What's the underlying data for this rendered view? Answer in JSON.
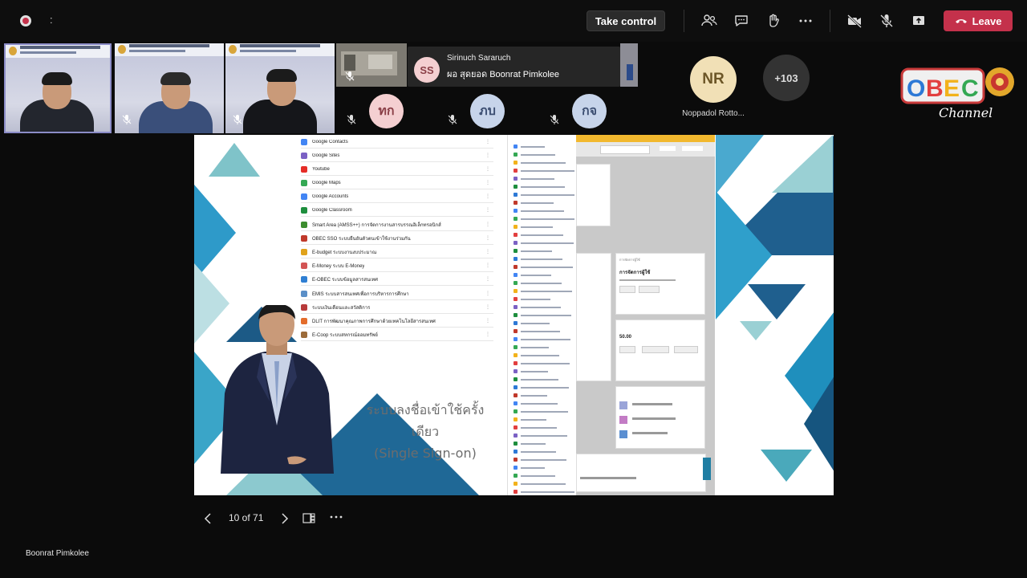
{
  "top_bar": {
    "recording_indicator": "record-icon",
    "timer_text": ":",
    "take_control_label": "Take control",
    "icons": [
      "people-icon",
      "chat-icon",
      "raise-hand-icon",
      "more-icon",
      "camera-off-icon",
      "mic-off-icon",
      "share-icon"
    ],
    "leave_label": "Leave",
    "leave_color": "#c4314b"
  },
  "participants": {
    "popup": {
      "initials": "SS",
      "line1": "Sirinuch Sararuch",
      "line2": "ผอ สุดยอด Boonrat Pimkolee"
    },
    "avatars": [
      {
        "initials": "ทก"
      },
      {
        "initials": "ภบ"
      },
      {
        "initials": "กจ"
      }
    ],
    "named_avatar": {
      "initials": "NR",
      "name": "Noppadol Rotto..."
    },
    "overflow_count": "+103"
  },
  "slide": {
    "caption_line1": "ระบบลงชื่อเข้าใช้ครั้งเดียว",
    "caption_line2": "(Single Sign-on)",
    "menu_items": [
      {
        "label": "Google Contacts",
        "color": "#4285f4"
      },
      {
        "label": "Google Sites",
        "color": "#7b61c4"
      },
      {
        "label": "Youtube",
        "color": "#e52d27"
      },
      {
        "label": "Google Maps",
        "color": "#34a853"
      },
      {
        "label": "Google Accounts",
        "color": "#4285f4"
      },
      {
        "label": "Google Classroom",
        "color": "#1e8e3e"
      },
      {
        "label": "Smart Area (AMSS++) การจัดการงานสารบรรณอิเล็กทรอนิกส์",
        "color": "#3c8d2f"
      },
      {
        "label": "OBEC SSO ระบบยืนยันตัวตนเข้าใช้งานร่วมกัน",
        "color": "#c0392b"
      },
      {
        "label": "E-budget ระบบงานงบประมาณ",
        "color": "#e0a21b"
      },
      {
        "label": "E-Money ระบบ E-Money",
        "color": "#d35454"
      },
      {
        "label": "E-OBEC ระบบข้อมูลสารสนเทศ",
        "color": "#2f7fd3"
      },
      {
        "label": "EMIS ระบบสารสนเทศเพื่อการบริหารการศึกษา",
        "color": "#5b8fc7"
      },
      {
        "label": "ระบบเงินเดือนและสวัสดิการ",
        "color": "#b83a3a"
      },
      {
        "label": "DLIT การพัฒนาคุณภาพการศึกษาด้วยเทคโนโลยีสารสนเทศ",
        "color": "#e36c2b"
      },
      {
        "label": "E-Coop ระบบสหกรณ์ออมทรัพย์",
        "color": "#9c6b3a"
      }
    ],
    "app_cards": [
      {
        "title": "การจัดการผู้ใช้"
      },
      {
        "title": "50.00"
      }
    ]
  },
  "slide_nav": {
    "page_label": "10 of 71"
  },
  "presenter_label": "Boonrat Pimkolee"
}
